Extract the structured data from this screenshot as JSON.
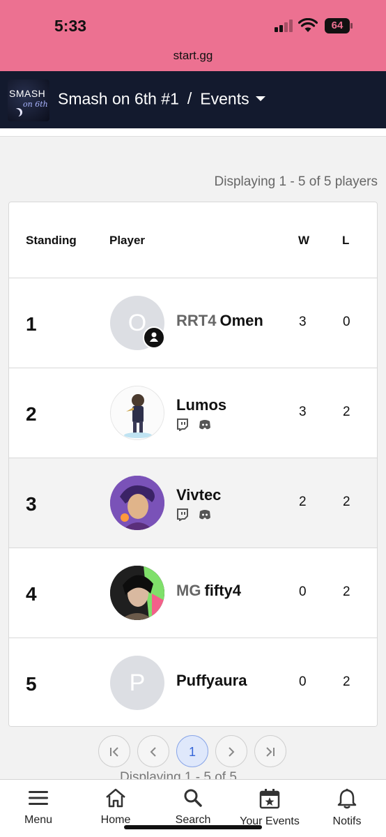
{
  "status": {
    "time": "5:33",
    "battery": "64",
    "url": "start.gg"
  },
  "header": {
    "logo_line1": "SMASH",
    "logo_line2": "on 6th",
    "tournament": "Smash on 6th #1",
    "separator": "/",
    "section": "Events"
  },
  "display_count": "Displaying 1 - 5 of 5 players",
  "table": {
    "headers": {
      "standing": "Standing",
      "player": "Player",
      "w": "W",
      "l": "L"
    },
    "rows": [
      {
        "standing": "1",
        "prefix": "RRT4",
        "name": "Omen",
        "initial": "O",
        "w": "3",
        "l": "0"
      },
      {
        "standing": "2",
        "prefix": "",
        "name": "Lumos",
        "initial": "",
        "w": "3",
        "l": "2"
      },
      {
        "standing": "3",
        "prefix": "",
        "name": "Vivtec",
        "initial": "",
        "w": "2",
        "l": "2"
      },
      {
        "standing": "4",
        "prefix": "MG",
        "name": "fifty4",
        "initial": "",
        "w": "0",
        "l": "2"
      },
      {
        "standing": "5",
        "prefix": "",
        "name": "Puffyaura",
        "initial": "P",
        "w": "0",
        "l": "2"
      }
    ]
  },
  "pagination": {
    "first": "|<",
    "prev": "<",
    "current": "1",
    "next": ">",
    "last": ">|",
    "repeat_text": "Displaying 1 - 5 of 5"
  },
  "bottom_nav": [
    {
      "label": "Menu",
      "icon": "hamburger-icon"
    },
    {
      "label": "Home",
      "icon": "home-icon"
    },
    {
      "label": "Search",
      "icon": "search-icon"
    },
    {
      "label": "Your Events",
      "icon": "calendar-star-icon"
    },
    {
      "label": "Notifs",
      "icon": "bell-icon"
    }
  ],
  "colors": {
    "status_bar": "#ec7191",
    "header_bg": "#131a2e",
    "page_bg": "#f2f2f2",
    "active_page": "#3465d8"
  }
}
